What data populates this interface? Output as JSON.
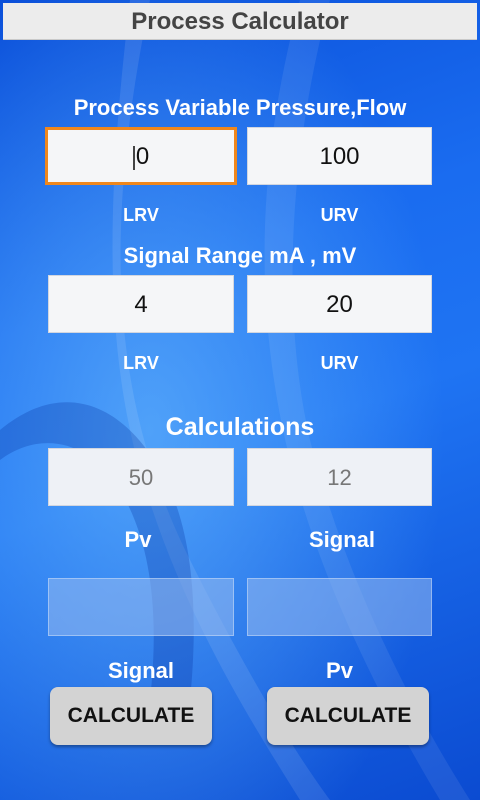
{
  "app": {
    "title": "Process Calculator"
  },
  "process_variable": {
    "heading": "Process Variable Pressure,Flow",
    "lrv_value": "0",
    "urv_value": "100",
    "lrv_label": "LRV",
    "urv_label": "URV"
  },
  "signal_range": {
    "heading": "Signal Range mA , mV",
    "lrv_value": "4",
    "urv_value": "20",
    "lrv_label": "LRV",
    "urv_label": "URV"
  },
  "calculations": {
    "heading": "Calculations",
    "pv_hint": "50",
    "signal_hint": "12",
    "pv_label": "Pv",
    "signal_label": "Signal",
    "result_signal_label": "Signal",
    "result_pv_label": "Pv"
  },
  "buttons": {
    "calculate_left": "CALCULATE",
    "calculate_right": "CALCULATE"
  }
}
